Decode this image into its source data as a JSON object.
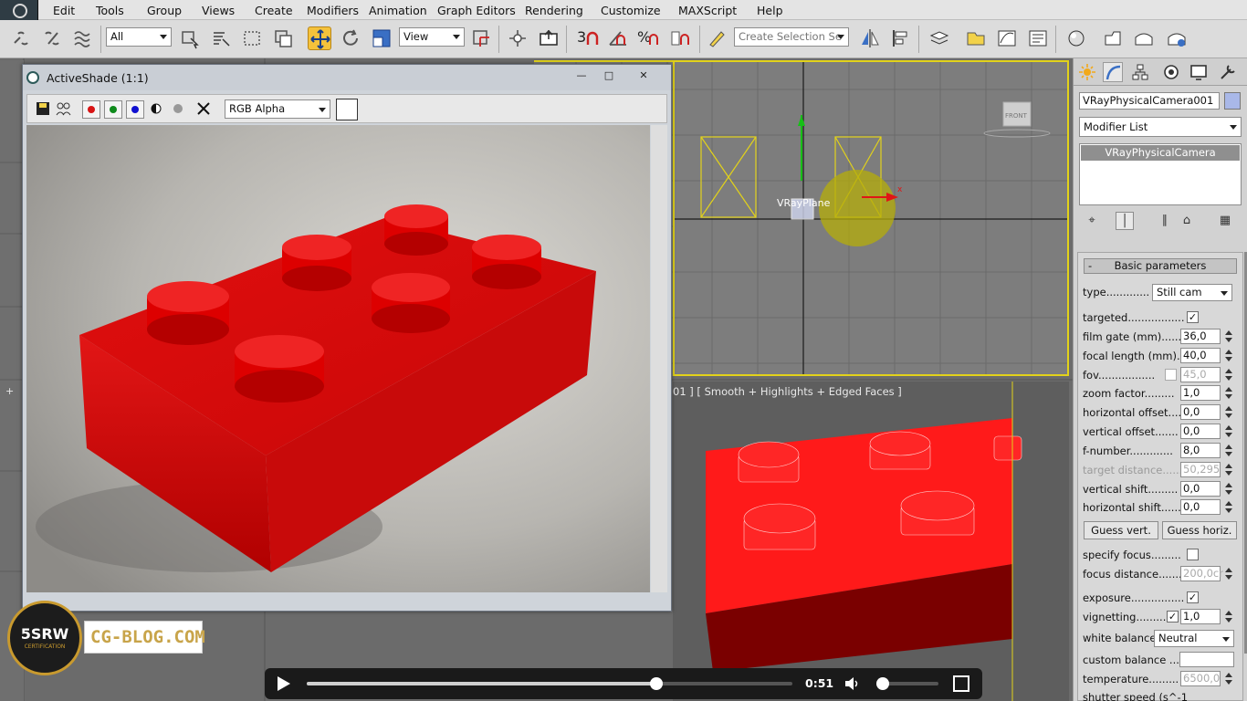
{
  "menu": [
    "Edit",
    "Tools",
    "Group",
    "Views",
    "Create",
    "Modifiers",
    "Animation",
    "Graph Editors",
    "Rendering",
    "Customize",
    "MAXScript",
    "Help"
  ],
  "toolbar": {
    "filter_dropdown": "All",
    "reference_dropdown": "View",
    "selection_set_placeholder": "Create Selection Se",
    "snap_label": "3",
    "percent_snap": "%"
  },
  "activeshade": {
    "title": "ActiveShade (1:1)",
    "channel": "RGB Alpha",
    "colors": {
      "red": "#d81414",
      "green": "#0f8a1c",
      "blue": "#1010d0"
    }
  },
  "viewports": {
    "front_label": "FRONT",
    "object_label": "VRayPlane",
    "perspective_label": "01 ] [ Smooth + Highlights + Edged Faces ]",
    "selection_color": "#e2d21a"
  },
  "command_panel": {
    "object_name": "VRayPhysicalCamera001",
    "object_color": "#a9b8e8",
    "modifier_list": "Modifier List",
    "stack_item": "VRayPhysicalCamera",
    "rollout_title": "Basic parameters",
    "rollout_toggle": "-",
    "params": {
      "type_label": "type.............",
      "type_value": "Still cam",
      "targeted_label": "targeted.................",
      "targeted_check": "✓",
      "film_gate_label": "film gate (mm).......",
      "film_gate_value": "36,0",
      "focal_length_label": "focal length (mm)...",
      "focal_length_value": "40,0",
      "fov_label": "fov.................",
      "fov_value": "45,0",
      "zoom_label": "zoom factor.........",
      "zoom_value": "1,0",
      "h_offset_label": "horizontal offset....",
      "h_offset_value": "0,0",
      "v_offset_label": "vertical offset.......",
      "v_offset_value": "0,0",
      "fnumber_label": "f-number.............",
      "fnumber_value": "8,0",
      "target_distance_label": "target distance......",
      "target_distance_value": "50,295",
      "v_shift_label": "vertical shift.........",
      "v_shift_value": "0,0",
      "h_shift_label": "horizontal shift......",
      "h_shift_value": "0,0",
      "guess_vert": "Guess vert.",
      "guess_horiz": "Guess horiz.",
      "specify_focus_label": "specify focus.........",
      "focus_distance_label": "focus distance........",
      "focus_distance_value": "200,0cr",
      "exposure_label": "exposure................",
      "exposure_check": "✓",
      "vignetting_label": "vignetting..........",
      "vignetting_check": "✓",
      "vignetting_value": "1,0",
      "white_balance_label": "white balance",
      "white_balance_value": "Neutral",
      "custom_balance_label": "custom balance .....",
      "temperature_label": "temperature.........",
      "temperature_value": "6500,0",
      "shutter_label": "shutter speed (s^-1"
    }
  },
  "logo": {
    "badge": "5SRW",
    "badge_sub": "CERTIFICATION",
    "site": "CG-BLOG.COM"
  },
  "player": {
    "time": "0:51",
    "progress": 0.72,
    "volume": 0
  }
}
